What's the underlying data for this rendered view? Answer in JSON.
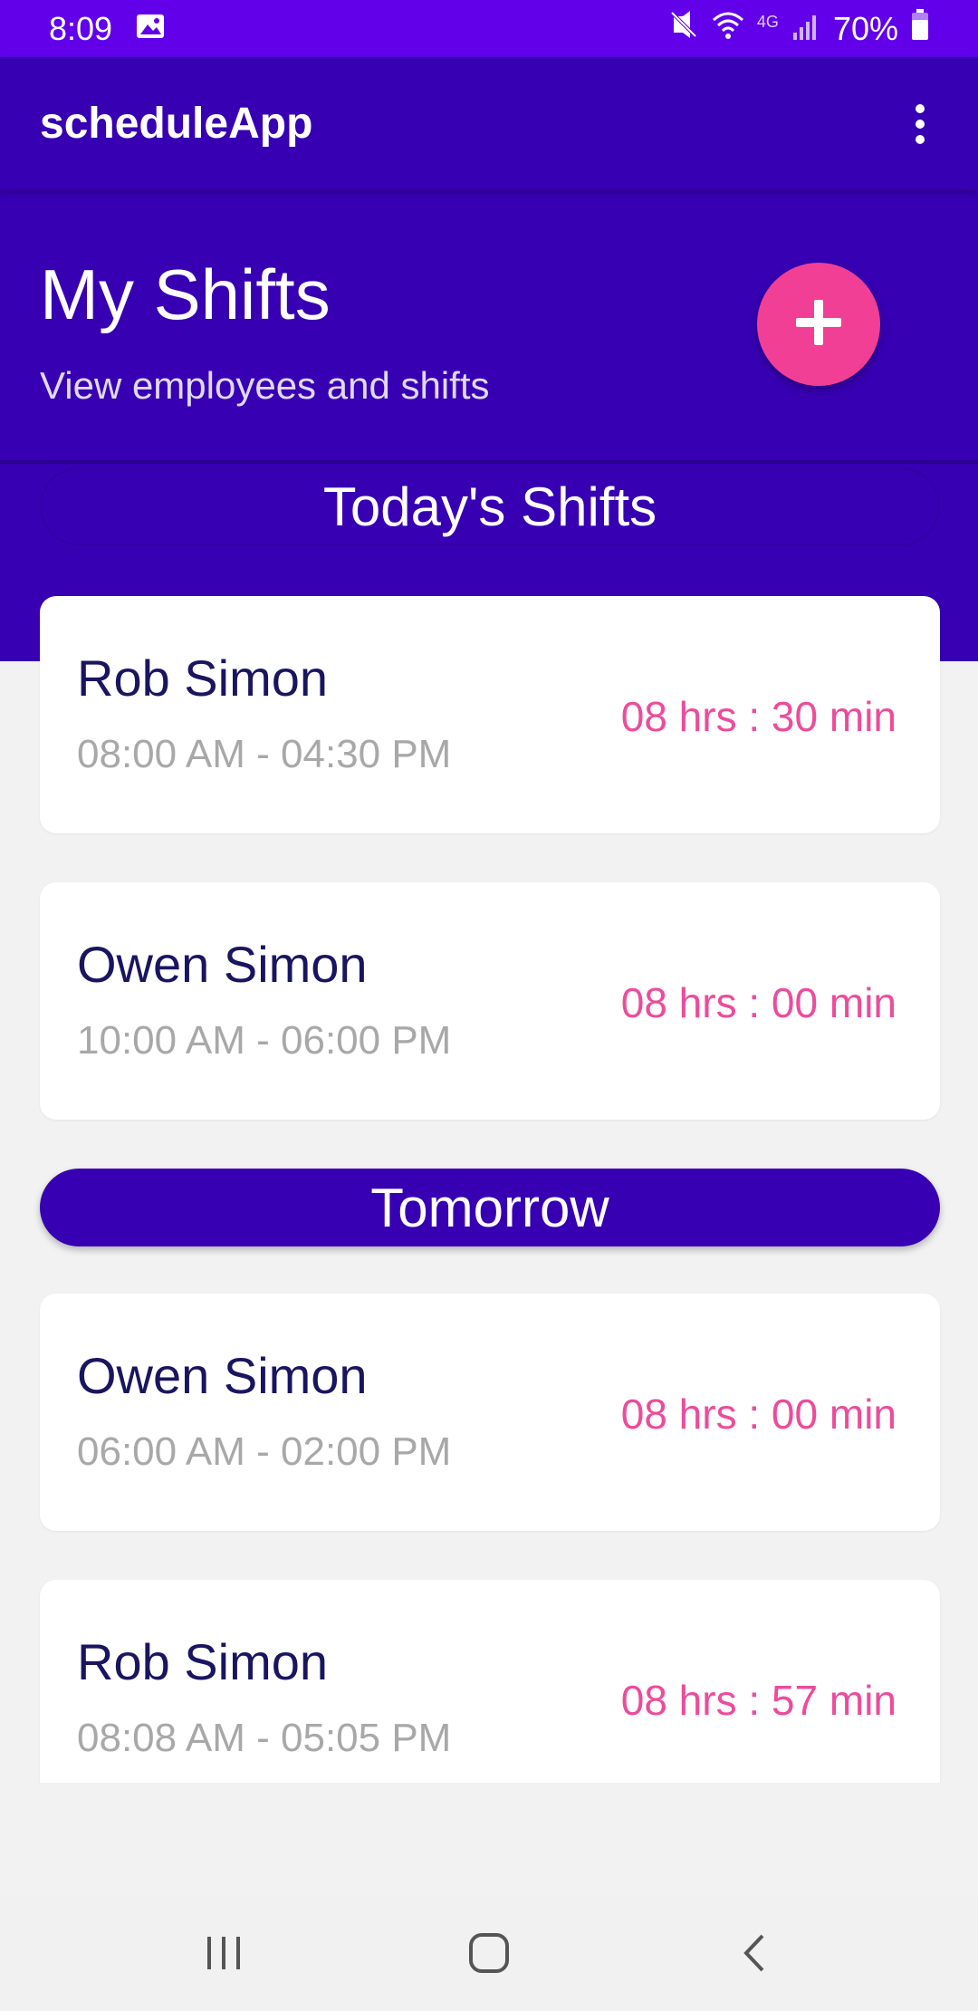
{
  "status_bar": {
    "time": "8:09",
    "network": "4G",
    "battery": "70%",
    "icons": [
      "image-icon",
      "mute-icon",
      "wifi-icon",
      "signal-icon",
      "battery-icon"
    ]
  },
  "app_bar": {
    "title": "scheduleApp",
    "menu_icon": "more-vert-icon"
  },
  "header": {
    "title": "My Shifts",
    "subtitle": "View employees and shifts",
    "fab_icon": "plus-icon"
  },
  "sections": {
    "today": "Today's Shifts",
    "tomorrow": "Tomorrow"
  },
  "shifts": [
    {
      "name": "Rob Simon",
      "time": "08:00 AM - 04:30 PM",
      "duration": "08 hrs : 30 min"
    },
    {
      "name": "Owen Simon",
      "time": "10:00 AM - 06:00 PM",
      "duration": "08 hrs : 00 min"
    },
    {
      "name": "Owen Simon",
      "time": "06:00 AM - 02:00 PM",
      "duration": "08 hrs : 00 min"
    },
    {
      "name": "Rob Simon",
      "time": "08:08 AM - 05:05 PM",
      "duration": "08 hrs : 57 min"
    }
  ],
  "colors": {
    "status_bar": "#6200ea",
    "primary": "#3700b3",
    "accent": "#f23f96",
    "duration_text": "#ec4c9b",
    "name_text": "#1a1560"
  }
}
